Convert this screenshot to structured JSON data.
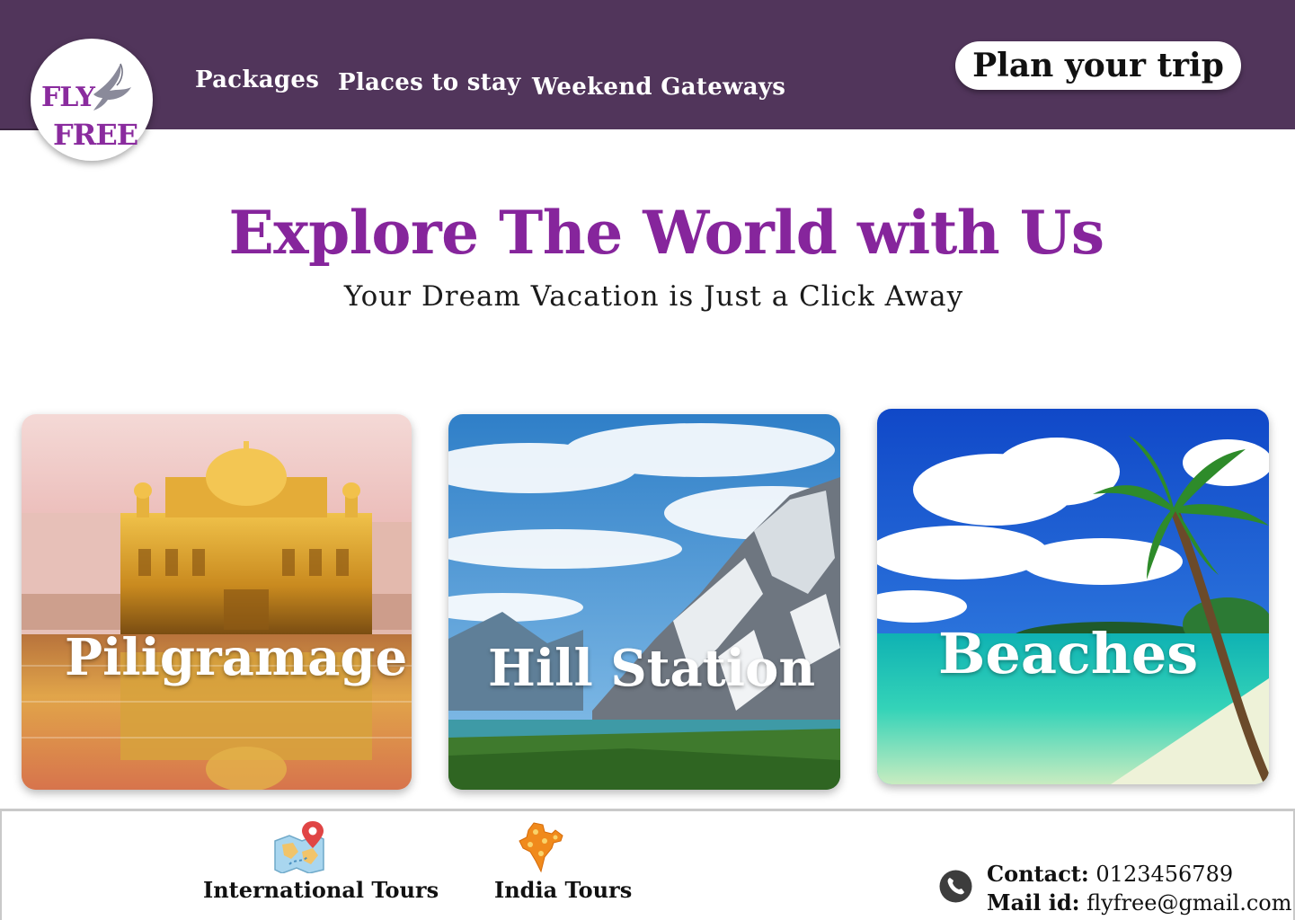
{
  "brand": {
    "logo_line1": "FLY",
    "logo_line2": "FREE",
    "colors": {
      "header_bg": "#51355b",
      "accent": "#86259c"
    }
  },
  "nav": {
    "items": [
      {
        "label": "Packages"
      },
      {
        "label": "Places to stay"
      },
      {
        "label": "Weekend Gateways"
      }
    ],
    "cta_label": "Plan your trip"
  },
  "hero": {
    "title": "Explore The World with Us",
    "subtitle": "Your Dream Vacation is Just a Click Away"
  },
  "cards": [
    {
      "label": "Piligramage",
      "icon": "golden-temple-photo"
    },
    {
      "label": "Hill Station",
      "icon": "mountain-lake-photo"
    },
    {
      "label": "Beaches",
      "icon": "tropical-beach-photo"
    }
  ],
  "footer": {
    "tours": [
      {
        "label": "International Tours",
        "icon": "world-map-icon"
      },
      {
        "label": "India Tours",
        "icon": "india-map-icon"
      }
    ],
    "contact": {
      "phone_label": "Contact:",
      "phone_value": "0123456789",
      "mail_label": "Mail id:",
      "mail_value": "flyfree@gmail.com",
      "icon": "phone-icon"
    }
  }
}
